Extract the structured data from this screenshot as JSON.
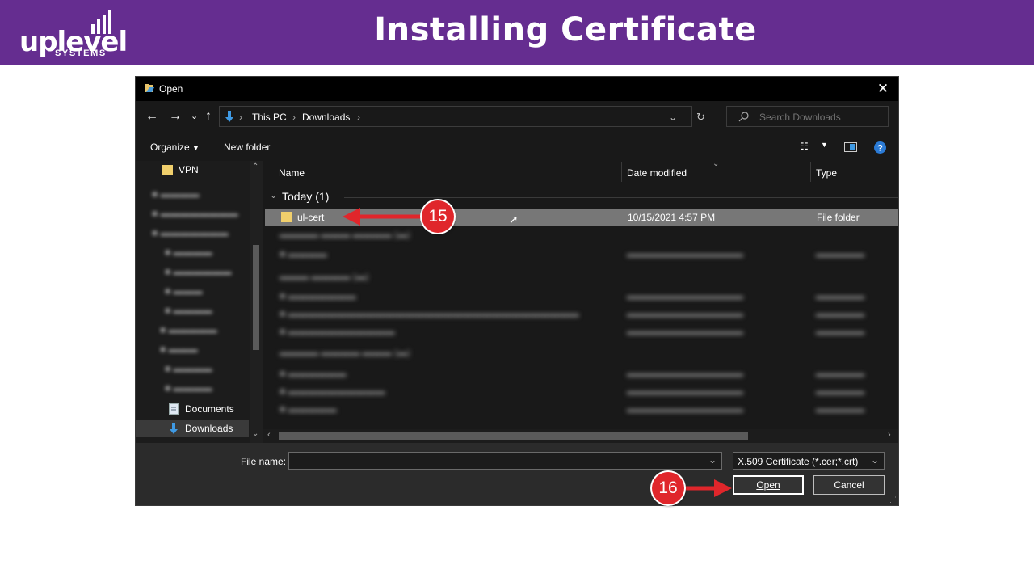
{
  "banner": {
    "title": "Installing Certificate",
    "logo_word": "uplevel",
    "logo_sub": "SYSTEMS",
    "color": "#652d90"
  },
  "dialog": {
    "title": "Open",
    "breadcrumb": [
      "This PC",
      "Downloads"
    ],
    "search_placeholder": "Search Downloads",
    "toolbar": {
      "organize": "Organize",
      "new_folder": "New folder"
    },
    "nav_items": [
      {
        "label": "VPN",
        "icon": "folder-icon"
      },
      {
        "label": "Documents",
        "icon": "documents-icon"
      },
      {
        "label": "Downloads",
        "icon": "downloads-icon"
      }
    ],
    "columns": [
      "Name",
      "Date modified",
      "Type"
    ],
    "group_today": "Today (1)",
    "selected_row": {
      "name": "ul-cert",
      "date": "10/15/2021 4:57 PM",
      "type": "File folder"
    },
    "file_name_label": "File name:",
    "file_name_value": "",
    "file_type": "X.509 Certificate (*.cer;*.crt)",
    "open_label": "Open",
    "cancel_label": "Cancel"
  },
  "callouts": {
    "first": "15",
    "second": "16",
    "color": "#e0262b"
  }
}
